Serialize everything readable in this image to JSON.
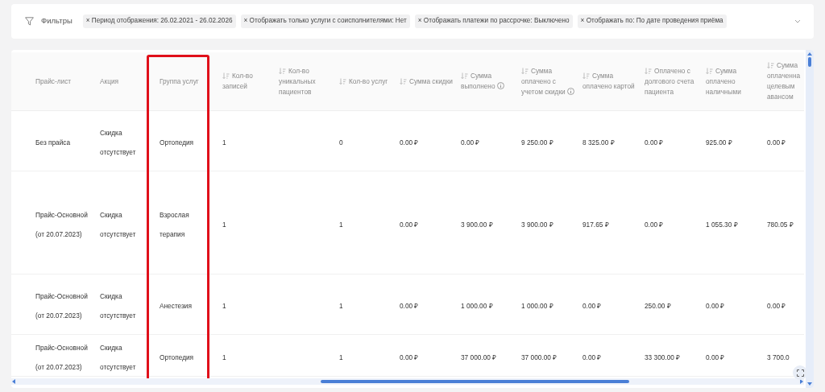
{
  "filters": {
    "title": "Фильтры",
    "chips": [
      {
        "label": "× Период отображения: 26.02.2021 - 26.02.2026"
      },
      {
        "label": "× Отображать только услуги с соисполнителями: Нет"
      },
      {
        "label": "× Отображать платежи по рассрочке: Выключено"
      },
      {
        "label": "× Отображать по: По дате проведения приёма"
      }
    ]
  },
  "table": {
    "columns": [
      {
        "label": "Прайс-лист",
        "sortable": false,
        "info": false,
        "highlighted": false
      },
      {
        "label": "Акция",
        "sortable": false,
        "info": false,
        "highlighted": false
      },
      {
        "label": "Группа услуг",
        "sortable": false,
        "info": false,
        "highlighted": true
      },
      {
        "label": "Кол-во записей",
        "sortable": true,
        "info": false,
        "highlighted": false
      },
      {
        "label": "Кол-во уникальных пациентов",
        "sortable": true,
        "info": false,
        "highlighted": false
      },
      {
        "label": "Кол-во услуг",
        "sortable": true,
        "info": false,
        "highlighted": false
      },
      {
        "label": "Сумма скидки",
        "sortable": true,
        "info": false,
        "highlighted": false
      },
      {
        "label": "Сумма выполнено",
        "sortable": true,
        "info": true,
        "highlighted": false
      },
      {
        "label": "Сумма оплачено с учетом скидки",
        "sortable": true,
        "info": true,
        "highlighted": false
      },
      {
        "label": "Сумма оплачено картой",
        "sortable": true,
        "info": false,
        "highlighted": false
      },
      {
        "label": "Оплачено с долгового счета пациента",
        "sortable": true,
        "info": false,
        "highlighted": false
      },
      {
        "label": "Сумма оплачено наличными",
        "sortable": true,
        "info": false,
        "highlighted": false
      },
      {
        "label": "Сумма оплаченна целевым авансом",
        "sortable": true,
        "info": false,
        "highlighted": false
      }
    ],
    "rows": [
      {
        "cells": [
          "Без прайса",
          "Скидка отсутствует",
          "Ортопедия",
          "1",
          "",
          "0",
          "0.00 ₽",
          "0.00 ₽",
          "9 250.00 ₽",
          "8 325.00 ₽",
          "0.00 ₽",
          "925.00 ₽",
          "0.00 ₽"
        ]
      },
      {
        "cells": [
          "Прайс-Основной (от 20.07.2023)",
          "Скидка отсутствует",
          "Взрослая терапия",
          "1",
          "",
          "1",
          "0.00 ₽",
          "3 900.00 ₽",
          "3 900.00 ₽",
          "917.65 ₽",
          "0.00 ₽",
          "1 055.30 ₽",
          "780.05 ₽"
        ]
      },
      {
        "cells": [
          "Прайс-Основной (от 20.07.2023)",
          "Скидка отсутствует",
          "Анестезия",
          "1",
          "",
          "1",
          "0.00 ₽",
          "1 000.00 ₽",
          "1 000.00 ₽",
          "0.00 ₽",
          "250.00 ₽",
          "0.00 ₽",
          "0.00 ₽"
        ]
      },
      {
        "cells": [
          "Прайс-Основной (от 20.07.2023)",
          "Скидка отсутствует",
          "Ортопедия",
          "1",
          "",
          "1",
          "0.00 ₽",
          "37 000.00 ₽",
          "37 000.00 ₽",
          "0.00 ₽",
          "33 300.00 ₽",
          "0.00 ₽",
          "3 700.0"
        ]
      }
    ]
  }
}
